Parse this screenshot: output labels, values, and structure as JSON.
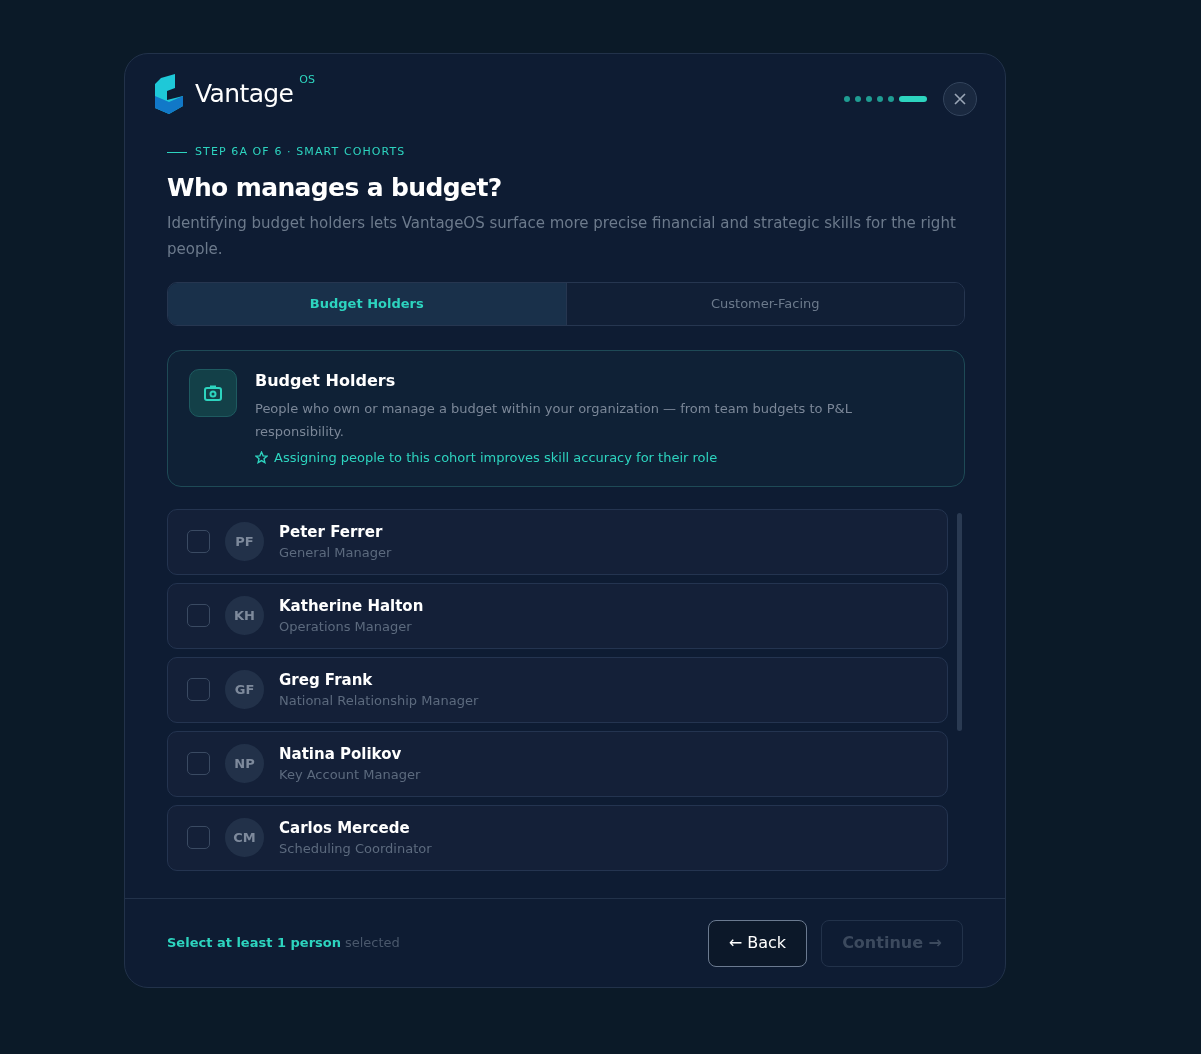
{
  "brand": {
    "name": "Vantage",
    "superscript": "OS"
  },
  "progress": [
    {
      "selected": false
    },
    {
      "selected": false
    },
    {
      "selected": false
    },
    {
      "selected": false
    },
    {
      "selected": false
    },
    {
      "selected": true
    }
  ],
  "step_label": "STEP 6A OF 6 · SMART COHORTS",
  "title": "Who manages a budget?",
  "subtitle": "Identifying budget holders lets VantageOS surface more precise financial and strategic skills for the right people.",
  "tabs": [
    {
      "label": "Budget Holders",
      "selected": true
    },
    {
      "label": "Customer-Facing",
      "selected": false
    }
  ],
  "cohort": {
    "title": "Budget Holders",
    "description": "People who own or manage a budget within your organization — from team budgets to P&L responsibility.",
    "hint": "Assigning people to this cohort improves skill accuracy for their role"
  },
  "people": [
    {
      "initials": "PF",
      "name": "Peter Ferrer",
      "role": "General Manager",
      "checked": false
    },
    {
      "initials": "KH",
      "name": "Katherine Halton",
      "role": "Operations Manager",
      "checked": false
    },
    {
      "initials": "GF",
      "name": "Greg Frank",
      "role": "National Relationship Manager",
      "checked": false
    },
    {
      "initials": "NP",
      "name": "Natina Polikov",
      "role": "Key Account Manager",
      "checked": false
    },
    {
      "initials": "CM",
      "name": "Carlos Mercede",
      "role": "Scheduling Coordinator",
      "checked": false
    }
  ],
  "footer": {
    "prompt": "Select at least 1 person",
    "suffix": "selected",
    "back": "← Back",
    "continue": {
      "label": "Continue →",
      "disabled": true
    }
  }
}
